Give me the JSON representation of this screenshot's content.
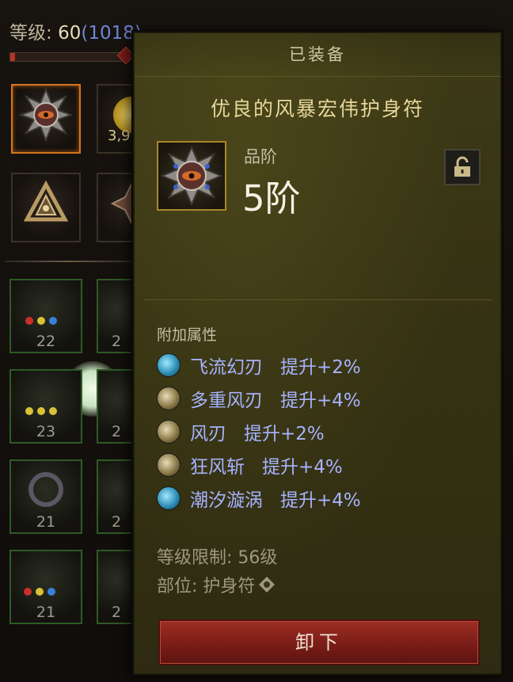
{
  "inventory": {
    "level_label": "等级: ",
    "level_value": "60",
    "paragon": "(1018)",
    "xp_fraction": 0.04,
    "gold_amount": "3,9",
    "item_levels": [
      "22",
      "2",
      "23",
      "2",
      "21",
      "2",
      "21",
      "2"
    ]
  },
  "tooltip": {
    "header": "已装备",
    "item_name": "优良的风暴宏伟护身符",
    "grade_label": "品阶",
    "grade_value": "5阶",
    "affix_title": "附加属性",
    "affixes": [
      {
        "icon": "water-skill-icon",
        "name": "飞流幻刃",
        "bonus": "提升+2%"
      },
      {
        "icon": "wind-skill-icon",
        "name": "多重风刃",
        "bonus": "提升+4%"
      },
      {
        "icon": "wind-skill-icon",
        "name": "风刃",
        "bonus": "提升+2%"
      },
      {
        "icon": "wind-skill-icon",
        "name": "狂风斩",
        "bonus": "提升+4%"
      },
      {
        "icon": "water-skill-icon",
        "name": "潮汐漩涡",
        "bonus": "提升+4%"
      }
    ],
    "level_requirement": "等级限制: 56级",
    "slot_label": "部位: 护身符",
    "unequip_label": "卸下"
  },
  "colors": {
    "affix_text": "#a7b3ff",
    "item_name": "#e6d79b",
    "unequip_button": "#8a2720"
  }
}
